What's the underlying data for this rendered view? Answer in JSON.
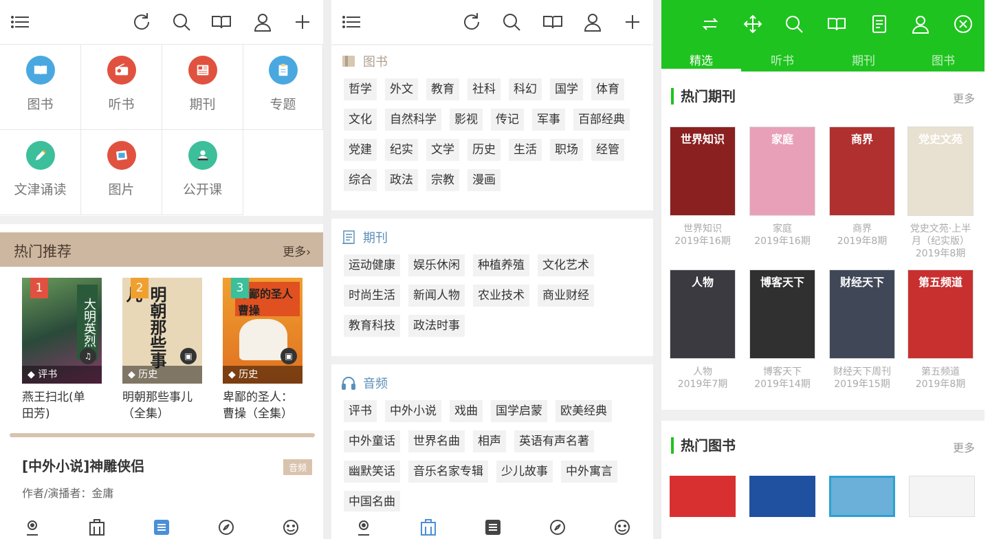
{
  "colors": {
    "green": "#1fc31f",
    "beige_header": "#cdb7a0",
    "accent_blue": "#5c8fb8",
    "nav_active": "#4a8fd8"
  },
  "panel1": {
    "toolbar_icons": [
      "menu-icon",
      "refresh-icon",
      "search-icon",
      "book-open-icon",
      "user-icon",
      "plus-icon"
    ],
    "grid": [
      {
        "label": "图书",
        "icon": "book-icon",
        "color": "#4aa8e0"
      },
      {
        "label": "听书",
        "icon": "radio-icon",
        "color": "#e0523f"
      },
      {
        "label": "期刊",
        "icon": "newspaper-icon",
        "color": "#e0523f"
      },
      {
        "label": "专题",
        "icon": "clipboard-icon",
        "color": "#4aa8e0"
      },
      {
        "label": "文津诵读",
        "icon": "pencil-icon",
        "color": "#3cbf9a"
      },
      {
        "label": "图片",
        "icon": "picture-icon",
        "color": "#e0523f"
      },
      {
        "label": "公开课",
        "icon": "lecturer-icon",
        "color": "#3cbf9a"
      }
    ],
    "hot": {
      "title": "热门推荐",
      "more": "更多",
      "books": [
        {
          "rank": "1",
          "tag": "评书",
          "title_line1": "燕王扫北(单",
          "title_line2": "田芳)",
          "rank_color": "#e0523f",
          "cover_text": "大明英烈"
        },
        {
          "rank": "2",
          "tag": "历史",
          "title_line1": "明朝那些事儿",
          "title_line2": "（全集）",
          "rank_color": "#f0a030",
          "cover_text": "明朝那些事儿"
        },
        {
          "rank": "3",
          "tag": "历史",
          "title_line1": "卑鄙的圣人：",
          "title_line2": "曹操（全集）",
          "rank_color": "#3cbf9a",
          "cover_text": "卑鄙的圣人曹操"
        }
      ]
    },
    "rec": {
      "title": "[中外小说]神雕侠侣",
      "badge": "音频",
      "author": "作者/演播者：金庸"
    },
    "nav_icons": [
      "home-icon",
      "library-icon",
      "list-icon",
      "compass-icon",
      "smile-icon"
    ]
  },
  "panel2": {
    "sections": [
      {
        "title": "图书",
        "icon": "book-icon",
        "chips": [
          "哲学",
          "外文",
          "教育",
          "社科",
          "科幻",
          "国学",
          "体育",
          "文化",
          "自然科学",
          "影视",
          "传记",
          "军事",
          "百部经典",
          "党建",
          "纪实",
          "文学",
          "历史",
          "生活",
          "职场",
          "经管",
          "综合",
          "政法",
          "宗教",
          "漫画"
        ]
      },
      {
        "title": "期刊",
        "icon": "journal-icon",
        "chips": [
          "运动健康",
          "娱乐休闲",
          "种植养殖",
          "文化艺术",
          "时尚生活",
          "新闻人物",
          "农业技术",
          "商业财经",
          "教育科技",
          "政法时事"
        ]
      },
      {
        "title": "音频",
        "icon": "headphones-icon",
        "chips": [
          "评书",
          "中外小说",
          "戏曲",
          "国学启蒙",
          "欧美经典",
          "中外童话",
          "世界名曲",
          "相声",
          "英语有声名著",
          "幽默笑话",
          "音乐名家专辑",
          "少儿故事",
          "中外寓言",
          "中国名曲"
        ]
      }
    ]
  },
  "panel3": {
    "tabs": [
      "精选",
      "听书",
      "期刊",
      "图书"
    ],
    "hot_journals": {
      "title": "热门期刊",
      "more": "更多"
    },
    "journals": [
      {
        "name": "世界知识",
        "issue": "2019年16期",
        "cover": "世界知识",
        "bg": "#8a2020"
      },
      {
        "name": "家庭",
        "issue": "2019年16期",
        "cover": "家庭",
        "bg": "#e8a0b8"
      },
      {
        "name": "商界",
        "issue": "2019年8期",
        "cover": "商界",
        "bg": "#b03030"
      },
      {
        "name": "党史文苑·上半月（纪实版）",
        "issue": "2019年8期",
        "cover": "党史文苑",
        "bg": "#e8e0d0"
      },
      {
        "name": "人物",
        "issue": "2019年7期",
        "cover": "人物",
        "bg": "#3a3a40"
      },
      {
        "name": "博客天下",
        "issue": "2019年14期",
        "cover": "博客天下",
        "bg": "#303030"
      },
      {
        "name": "财经天下周刊",
        "issue": "2019年15期",
        "cover": "财经天下",
        "bg": "#404858"
      },
      {
        "name": "第五频道",
        "issue": "2019年8期",
        "cover": "第五频道",
        "bg": "#c83030"
      }
    ],
    "hot_books": {
      "title": "热门图书",
      "more": "更多"
    }
  }
}
